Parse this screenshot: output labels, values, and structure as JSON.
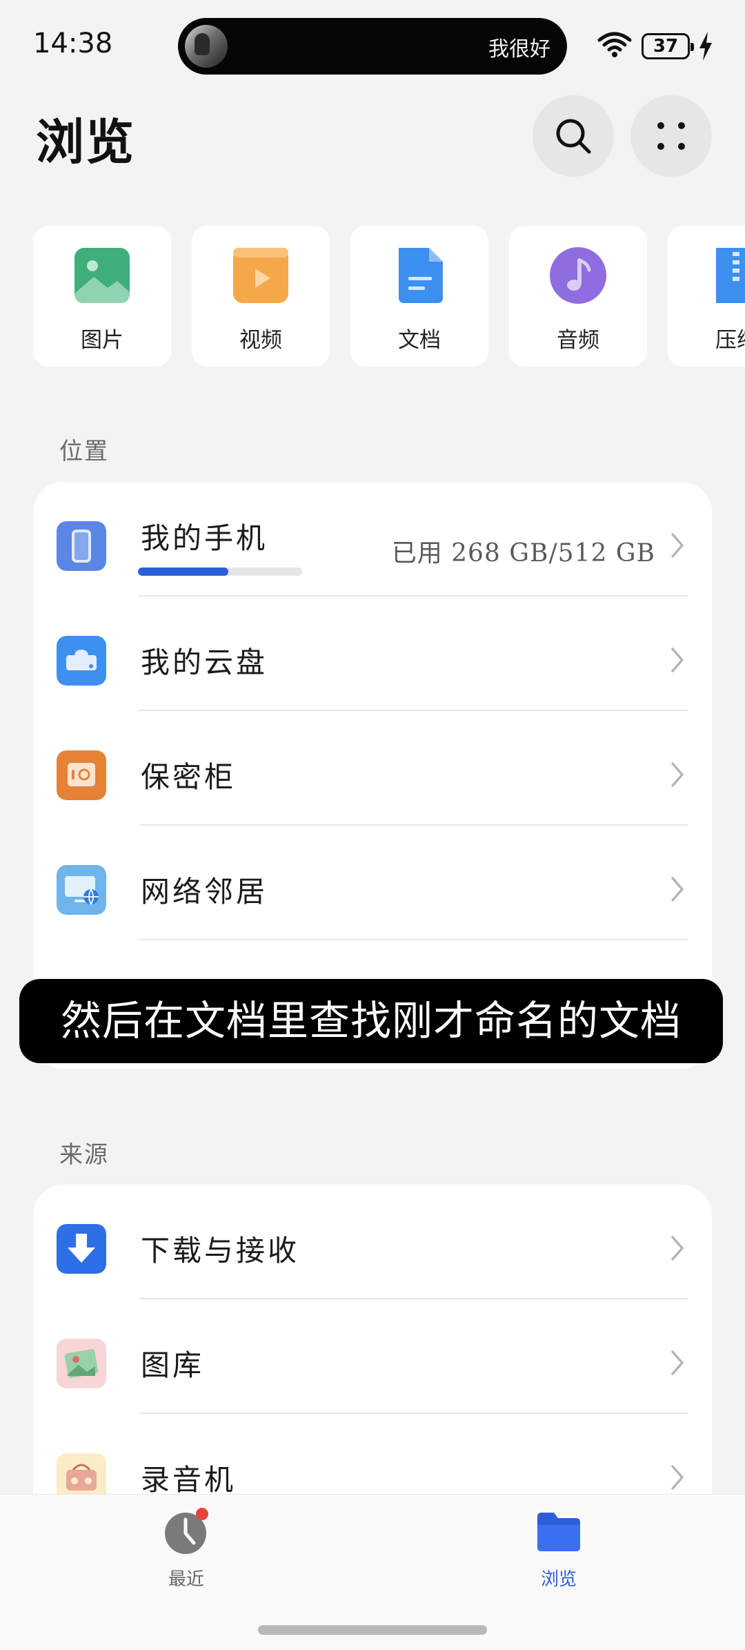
{
  "status_bar": {
    "time": "14:38",
    "media_text": "我很好",
    "battery": "37"
  },
  "header": {
    "title": "浏览"
  },
  "categories": [
    {
      "label": "图片",
      "icon": "image-icon",
      "color": "#3fae7b"
    },
    {
      "label": "视频",
      "icon": "video-icon",
      "color": "#f4a849"
    },
    {
      "label": "文档",
      "icon": "document-icon",
      "color": "#3d8ff0"
    },
    {
      "label": "音频",
      "icon": "audio-icon",
      "color": "#8f6de0"
    },
    {
      "label": "压缩",
      "icon": "archive-icon",
      "color": "#3d8ff0"
    }
  ],
  "locations": {
    "section_label": "位置",
    "items": [
      {
        "label": "我的手机",
        "icon": "phone-icon",
        "storage": "已用 268 GB/512 GB",
        "used_fraction": 0.55
      },
      {
        "label": "我的云盘",
        "icon": "cloud-drive-icon"
      },
      {
        "label": "保密柜",
        "icon": "safe-icon"
      },
      {
        "label": "网络邻居",
        "icon": "network-neighbor-icon"
      }
    ]
  },
  "caption": "然后在文档里查找刚才命名的文档",
  "sources": {
    "section_label": "来源",
    "items": [
      {
        "label": "下载与接收",
        "icon": "download-icon"
      },
      {
        "label": "图库",
        "icon": "gallery-icon"
      },
      {
        "label": "录音机",
        "icon": "recorder-icon"
      }
    ]
  },
  "bottom_nav": {
    "items": [
      {
        "label": "最近",
        "icon": "clock-icon",
        "active": false
      },
      {
        "label": "浏览",
        "icon": "folder-icon",
        "active": true
      }
    ],
    "active_color": "#2c5ed8",
    "inactive_color": "#666666"
  }
}
